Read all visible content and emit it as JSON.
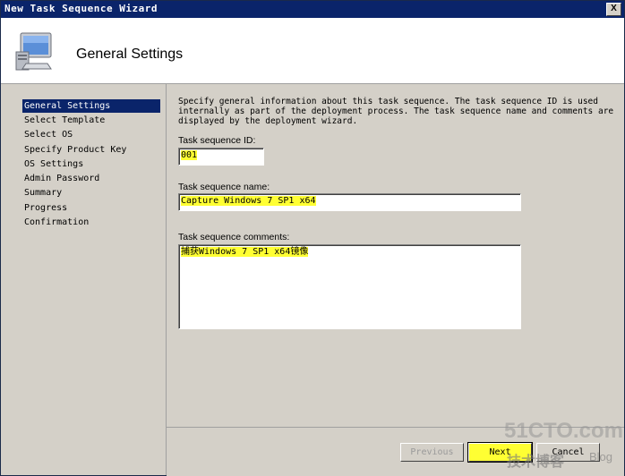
{
  "window": {
    "title": "New Task Sequence Wizard",
    "close_label": "X"
  },
  "header": {
    "title": "General Settings",
    "icon": "computer-monitor-icon"
  },
  "steps": [
    {
      "label": "General Settings",
      "active": true
    },
    {
      "label": "Select Template"
    },
    {
      "label": "Select OS"
    },
    {
      "label": "Specify Product Key"
    },
    {
      "label": "OS Settings"
    },
    {
      "label": "Admin Password"
    },
    {
      "label": "Summary"
    },
    {
      "label": "Progress"
    },
    {
      "label": "Confirmation"
    }
  ],
  "content": {
    "description": "Specify general information about this task sequence.  The task sequence ID is used internally as part of the deployment process.  The task sequence name and comments are displayed by the deployment wizard.",
    "id_label": "Task sequence ID:",
    "id_value": "001",
    "name_label": "Task sequence name:",
    "name_value": "Capture Windows 7 SP1 x64",
    "comments_label": "Task sequence comments:",
    "comments_value": "捕获Windows 7 SP1 x64镜像"
  },
  "buttons": {
    "previous": "Previous",
    "next": "Next",
    "cancel": "Cancel"
  },
  "watermark": {
    "site": "51CTO.com",
    "sub": "技术博客",
    "blog": "Blog"
  },
  "colors": {
    "highlight": "#ffff33",
    "title_bar": "#0a246a",
    "selected_step": "#0a246a"
  }
}
